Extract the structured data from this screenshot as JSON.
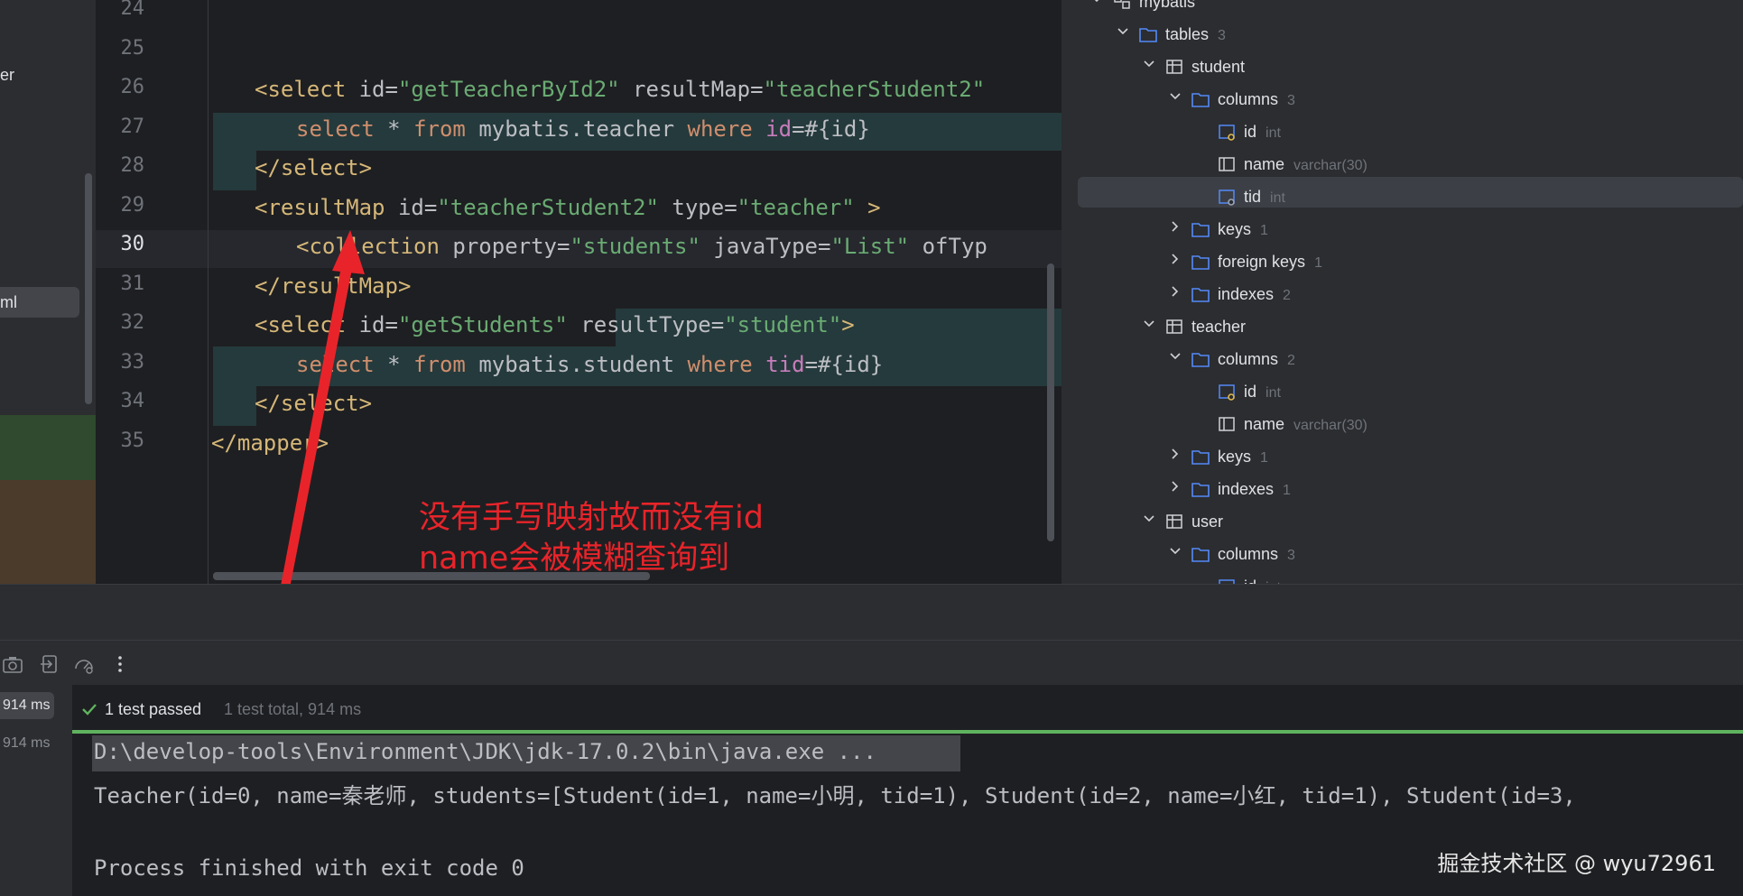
{
  "project_panel": {
    "items": [
      {
        "label": "er"
      },
      {
        "label": "ml"
      }
    ]
  },
  "editor": {
    "line_numbers": [
      "24",
      "25",
      "26",
      "27",
      "28",
      "29",
      "30",
      "31",
      "32",
      "33",
      "34",
      "35"
    ],
    "current_line": "30",
    "lines": [
      [],
      [],
      [
        {
          "t": "<select ",
          "c": "tag"
        },
        {
          "t": "id=",
          "c": "attr"
        },
        {
          "t": "\"getTeacherById2\"",
          "c": "str"
        },
        {
          "t": " resultMap=",
          "c": "attr"
        },
        {
          "t": "\"teacherStudent2\"",
          "c": "str"
        }
      ],
      [
        {
          "t": "select ",
          "c": "kw"
        },
        {
          "t": "* ",
          "c": "attr"
        },
        {
          "t": "from ",
          "c": "kw"
        },
        {
          "t": "mybatis.teacher ",
          "c": "attr"
        },
        {
          "t": "where ",
          "c": "kw"
        },
        {
          "t": "id",
          "c": "fld"
        },
        {
          "t": "=#{id}",
          "c": "attr"
        }
      ],
      [
        {
          "t": "</select>",
          "c": "tag"
        }
      ],
      [
        {
          "t": "<resultMap ",
          "c": "tag"
        },
        {
          "t": "id=",
          "c": "attr"
        },
        {
          "t": "\"teacherStudent2\"",
          "c": "str"
        },
        {
          "t": " type=",
          "c": "attr"
        },
        {
          "t": "\"teacher\"",
          "c": "str"
        },
        {
          "t": " >",
          "c": "tag"
        }
      ],
      [
        {
          "t": "<collection ",
          "c": "tag"
        },
        {
          "t": "property=",
          "c": "attr"
        },
        {
          "t": "\"students\"",
          "c": "str"
        },
        {
          "t": " javaType=",
          "c": "attr"
        },
        {
          "t": "\"List\"",
          "c": "str"
        },
        {
          "t": " ofTyp",
          "c": "attr"
        }
      ],
      [
        {
          "t": "</resultMap>",
          "c": "tag"
        }
      ],
      [
        {
          "t": "<select ",
          "c": "tag"
        },
        {
          "t": "id=",
          "c": "attr"
        },
        {
          "t": "\"getStudents\"",
          "c": "str"
        },
        {
          "t": " resultType=",
          "c": "attr"
        },
        {
          "t": "\"student\"",
          "c": "str"
        },
        {
          "t": ">",
          "c": "tag"
        }
      ],
      [
        {
          "t": "select ",
          "c": "kw"
        },
        {
          "t": "* ",
          "c": "attr"
        },
        {
          "t": "from ",
          "c": "kw"
        },
        {
          "t": "mybatis.student ",
          "c": "attr"
        },
        {
          "t": "where ",
          "c": "kw"
        },
        {
          "t": "tid",
          "c": "fld"
        },
        {
          "t": "=#{id}",
          "c": "attr"
        }
      ],
      [
        {
          "t": "</select>",
          "c": "tag"
        }
      ],
      [
        {
          "t": "</mapper>",
          "c": "tag"
        }
      ]
    ]
  },
  "annotation": {
    "line1": "没有手写映射故而没有id",
    "line2": "name会被模糊查询到"
  },
  "db_tree": {
    "rows": [
      {
        "label": "mybatis",
        "meta": "",
        "icon": "schema-icon",
        "expanded": true
      },
      {
        "label": "tables",
        "meta": "3",
        "icon": "folder-icon",
        "expanded": true
      },
      {
        "label": "student",
        "meta": "",
        "icon": "table-icon",
        "expanded": true
      },
      {
        "label": "columns",
        "meta": "3",
        "icon": "folder-icon",
        "expanded": true
      },
      {
        "label": "id",
        "meta": "int",
        "icon": "key-column-icon",
        "expanded": null
      },
      {
        "label": "name",
        "meta": "varchar(30)",
        "icon": "column-icon",
        "expanded": null
      },
      {
        "label": "tid",
        "meta": "int",
        "icon": "foreign-key-column-icon",
        "expanded": null
      },
      {
        "label": "keys",
        "meta": "1",
        "icon": "folder-icon",
        "expanded": false
      },
      {
        "label": "foreign keys",
        "meta": "1",
        "icon": "folder-icon",
        "expanded": false
      },
      {
        "label": "indexes",
        "meta": "2",
        "icon": "folder-icon",
        "expanded": false
      },
      {
        "label": "teacher",
        "meta": "",
        "icon": "table-icon",
        "expanded": true
      },
      {
        "label": "columns",
        "meta": "2",
        "icon": "folder-icon",
        "expanded": true
      },
      {
        "label": "id",
        "meta": "int",
        "icon": "key-column-icon",
        "expanded": null
      },
      {
        "label": "name",
        "meta": "varchar(30)",
        "icon": "column-icon",
        "expanded": null
      },
      {
        "label": "keys",
        "meta": "1",
        "icon": "folder-icon",
        "expanded": false
      },
      {
        "label": "indexes",
        "meta": "1",
        "icon": "folder-icon",
        "expanded": false
      },
      {
        "label": "user",
        "meta": "",
        "icon": "table-icon",
        "expanded": true
      },
      {
        "label": "columns",
        "meta": "3",
        "icon": "folder-icon",
        "expanded": true
      },
      {
        "label": "id",
        "meta": "int",
        "icon": "key-column-icon",
        "expanded": null
      }
    ],
    "selected_index": 6
  },
  "test_runner": {
    "toolbar_icons": [
      "camera-icon",
      "export-icon",
      "gauge-icon",
      "more-icon"
    ],
    "times": [
      "914 ms",
      "914 ms"
    ],
    "status_passed": "1 test passed",
    "status_total": "1 test total, 914 ms"
  },
  "console": {
    "lines": [
      "D:\\develop-tools\\Environment\\JDK\\jdk-17.0.2\\bin\\java.exe ...",
      "Teacher(id=0, name=秦老师, students=[Student(id=1, name=小明, tid=1), Student(id=2, name=小红, tid=1), Student(id=3, ",
      "",
      "Process finished with exit code 0"
    ]
  },
  "watermark": "掘金技术社区 @ wyu72961",
  "colors": {
    "tag": "#d5b778",
    "string": "#6aab73",
    "keyword": "#cf8e6d",
    "field": "#c77dbb",
    "annotation": "#e8242a",
    "progress": "#5fb35e",
    "folder": "#548af7"
  }
}
